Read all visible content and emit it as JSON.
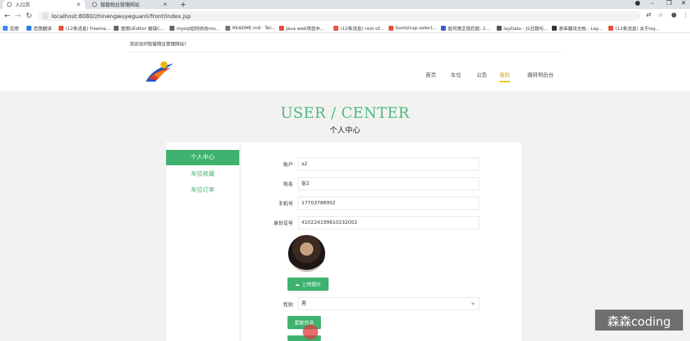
{
  "browser": {
    "tabs": [
      {
        "title": "入口页",
        "active": true
      },
      {
        "title": "智能物业管理网站",
        "active": false
      }
    ],
    "url": "localhost:8080/zhinengwuyeguanli/front/index.jsp",
    "bookmarks": [
      {
        "label": "应用",
        "color": "#4285f4"
      },
      {
        "label": "百度翻译",
        "color": "#2a7de1"
      },
      {
        "label": "(12条消息) freema...",
        "color": "#e5533d"
      },
      {
        "label": "使用UEditor 报错C...",
        "color": "#666666"
      },
      {
        "label": "mysql如何修改roo...",
        "color": "#666666"
      },
      {
        "label": "README.md · Ter...",
        "color": "#777777"
      },
      {
        "label": "(12条消息) root of...",
        "color": "#e5533d"
      },
      {
        "label": "Java web项目中...",
        "color": "#e5533d"
      },
      {
        "label": "bootstrap-select...",
        "color": "#e5533d"
      },
      {
        "label": "如何用正则匹配: 2...",
        "color": "#3b5bdb"
      },
      {
        "label": "layDate - JS日期与...",
        "color": "#555555"
      },
      {
        "label": "表单模块文档 - Lay...",
        "color": "#333333"
      },
      {
        "label": "(12条消息) 关于lay...",
        "color": "#e5533d"
      }
    ]
  },
  "site": {
    "welcome": "欢迎访问智能物业管理网站！",
    "nav": [
      {
        "label": "首页",
        "active": false
      },
      {
        "label": "车位",
        "active": false
      },
      {
        "label": "公告",
        "active": false
      },
      {
        "label": "我的",
        "active": true
      },
      {
        "label": "跳转到后台",
        "active": false
      }
    ],
    "headline": "USER / CENTER",
    "subheadline": "个人中心"
  },
  "sidebar": {
    "items": [
      {
        "label": "个人中心",
        "active": true
      },
      {
        "label": "车位收藏",
        "active": false
      },
      {
        "label": "车位订单",
        "active": false
      }
    ]
  },
  "form": {
    "fields": [
      {
        "label": "账户",
        "value": "a2"
      },
      {
        "label": "姓名",
        "value": "张2"
      },
      {
        "label": "手机号",
        "value": "17703786902"
      },
      {
        "label": "身份证号",
        "value": "410224199610232002"
      }
    ],
    "upload_label": "上传图片",
    "gender_label": "性别",
    "gender_value": "男",
    "update_label": "更新信息"
  },
  "watermark": "森森coding",
  "colors": {
    "accent": "#3fb26f",
    "headline": "#4dbb7c",
    "nav_active": "#c9a400"
  }
}
